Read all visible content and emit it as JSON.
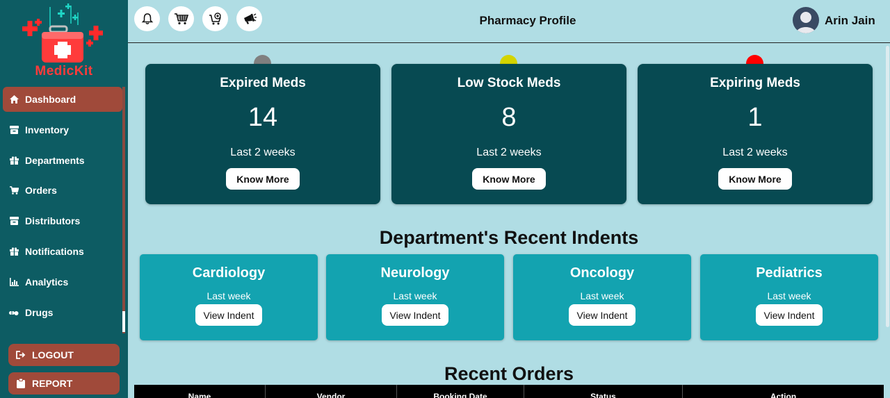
{
  "brand": {
    "name": "MedicKit",
    "logo_icon": "medical-kit-icon"
  },
  "sidebar": {
    "items": [
      {
        "label": "Dashboard",
        "icon": "home-icon",
        "active": true
      },
      {
        "label": "Inventory",
        "icon": "box-icon"
      },
      {
        "label": "Departments",
        "icon": "gift-icon"
      },
      {
        "label": "Orders",
        "icon": "cart-icon"
      },
      {
        "label": "Distributors",
        "icon": "box-icon"
      },
      {
        "label": "Notifications",
        "icon": "gift-icon"
      },
      {
        "label": "Analytics",
        "icon": "chart-icon"
      },
      {
        "label": "Drugs",
        "icon": "pills-icon"
      }
    ],
    "logout_label": "LOGOUT",
    "report_label": "REPORT"
  },
  "header": {
    "title": "Pharmacy Profile",
    "user_name": "Arin Jain",
    "icons": [
      "bell-icon",
      "cart-icon",
      "cart-add-icon",
      "megaphone-icon"
    ]
  },
  "stats": [
    {
      "title": "Expired Meds",
      "value": "14",
      "sub": "Last 2 weeks",
      "button": "Know More",
      "dot_color": "#808080"
    },
    {
      "title": "Low Stock Meds",
      "value": "8",
      "sub": "Last 2 weeks",
      "button": "Know More",
      "dot_color": "#d4d400"
    },
    {
      "title": "Expiring Meds",
      "value": "1",
      "sub": "Last 2 weeks",
      "button": "Know More",
      "dot_color": "#ff0000"
    }
  ],
  "departments_section": {
    "title": "Department's Recent Indents",
    "items": [
      {
        "name": "Cardiology",
        "sub": "Last week",
        "button": "View Indent"
      },
      {
        "name": "Neurology",
        "sub": "Last week",
        "button": "View Indent"
      },
      {
        "name": "Oncology",
        "sub": "Last week",
        "button": "View Indent"
      },
      {
        "name": "Pediatrics",
        "sub": "Last week",
        "button": "View Indent"
      }
    ]
  },
  "orders_section": {
    "title": "Recent Orders",
    "columns": [
      "Name",
      "Vendor",
      "Booking Date",
      "Status",
      "Action"
    ]
  },
  "colors": {
    "sidebar": "#0d5c63",
    "accent": "#a04a3a",
    "stat_card": "#074a52",
    "dept_card": "#13a3b0",
    "page_bg": "#b0dde4"
  }
}
